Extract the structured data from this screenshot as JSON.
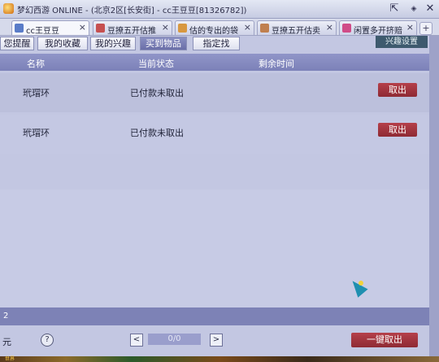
{
  "window": {
    "title": "梦幻西游 ONLINE - (北京2区[长安街] - cc王豆豆[81326782])",
    "pin_icon": "pin-icon",
    "close_icon": "close-icon"
  },
  "browser_tabs": [
    {
      "label": "cc王豆豆",
      "active": true,
      "icon_color": "#5a7cc8"
    },
    {
      "label": "豆撩五开估推",
      "active": false,
      "icon_color": "#c65050"
    },
    {
      "label": "估的专出的袋",
      "active": false,
      "icon_color": "#d89840"
    },
    {
      "label": "豆撩五开估卖",
      "active": false,
      "icon_color": "#c08050"
    },
    {
      "label": "闲置多开挤赔",
      "active": false,
      "icon_color": "#d04c88"
    }
  ],
  "new_tab_label": "+",
  "sub_tabs": [
    {
      "label": "您提醒",
      "active": false
    },
    {
      "label": "我的收藏",
      "active": false
    },
    {
      "label": "我的兴趣",
      "active": false
    },
    {
      "label": "买到物品",
      "active": true
    },
    {
      "label": "指定找",
      "active": false
    }
  ],
  "settings_button": "兴趣设置",
  "table": {
    "headers": [
      "名称",
      "当前状态",
      "剩余时间"
    ],
    "rows": [
      {
        "name": "玳瑁环",
        "status": "已付款未取出",
        "remaining": "",
        "action": "取出"
      },
      {
        "name": "玳瑁环",
        "status": "已付款未取出",
        "remaining": "",
        "action": "取出"
      }
    ]
  },
  "footer": {
    "count": "2",
    "currency_unit": "元",
    "help_label": "?",
    "prev_label": "<",
    "page": "0/0",
    "next_label": ">",
    "take_all_label": "一键取出"
  },
  "taskbar": {
    "shop_label": "世界"
  },
  "colors": {
    "accent": "#7c81b8",
    "action_button": "#a33a44",
    "panel_bg": "#c3c7e2"
  }
}
